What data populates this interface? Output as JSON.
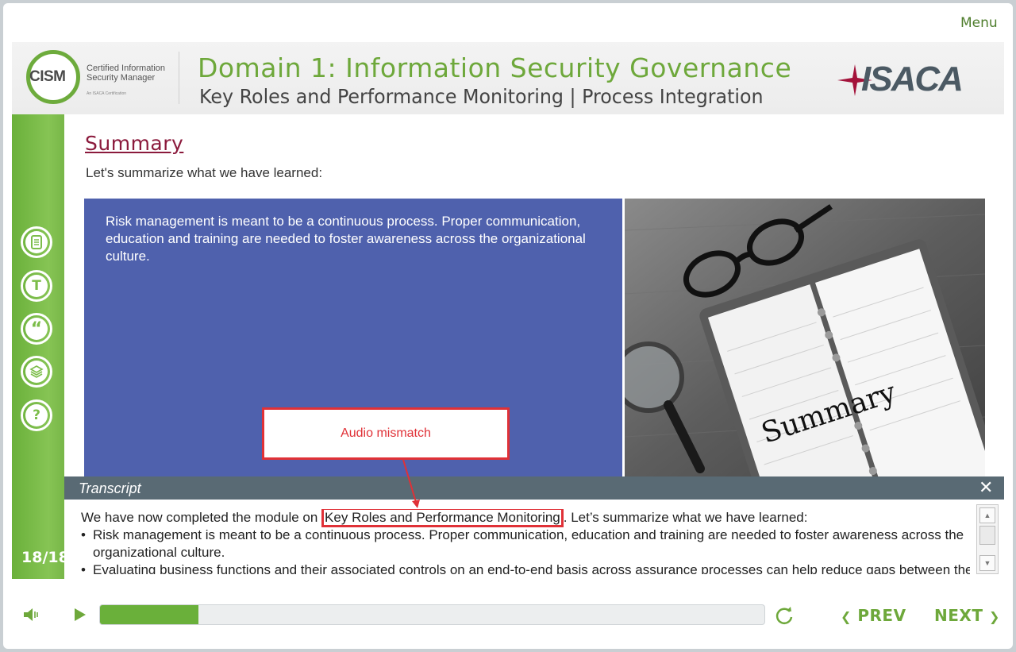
{
  "app": {
    "menu_label": "Menu"
  },
  "header": {
    "logo_left": {
      "abbrev": "CISM",
      "line1": "Certified Information",
      "line2": "Security Manager",
      "tagline": "An ISACA Certification"
    },
    "title": "Domain 1: Information Security Governance",
    "subtitle": "Key Roles and Performance Monitoring | Process Integration",
    "logo_right": "ISACA"
  },
  "sidebar": {
    "items": [
      {
        "icon": "notes-icon",
        "label": "N"
      },
      {
        "icon": "text-icon",
        "label": "T"
      },
      {
        "icon": "quote-icon",
        "label": "“"
      },
      {
        "icon": "layers-icon",
        "label": "≋"
      },
      {
        "icon": "help-icon",
        "label": "?"
      }
    ],
    "page_counter": "18/18"
  },
  "main": {
    "heading": "Summary",
    "lead": "Let's summarize what we have learned:",
    "panel_text": "Risk management is meant to be a continuous process. Proper communication, education and training are needed to foster awareness across the organizational culture.",
    "photo_word": "Summary"
  },
  "callout": {
    "label": "Audio mismatch"
  },
  "transcript": {
    "title": "Transcript",
    "close_icon": "close-icon",
    "intro_before": "We have now completed the module on ",
    "intro_highlight": "Key Roles and Performance Monitoring",
    "intro_after": ". Let’s summarize what we have learned:",
    "bullets": [
      "Risk management is meant to be a continuous process. Proper communication, education and training are needed to foster awareness across the organizational culture.",
      "Evaluating business functions and their associated controls on an end-to-end basis across assurance processes can help reduce gaps between these"
    ]
  },
  "controls": {
    "progress": 0.148,
    "prev_label": "PREV",
    "next_label": "NEXT",
    "accent_color": "#6ab03a"
  }
}
